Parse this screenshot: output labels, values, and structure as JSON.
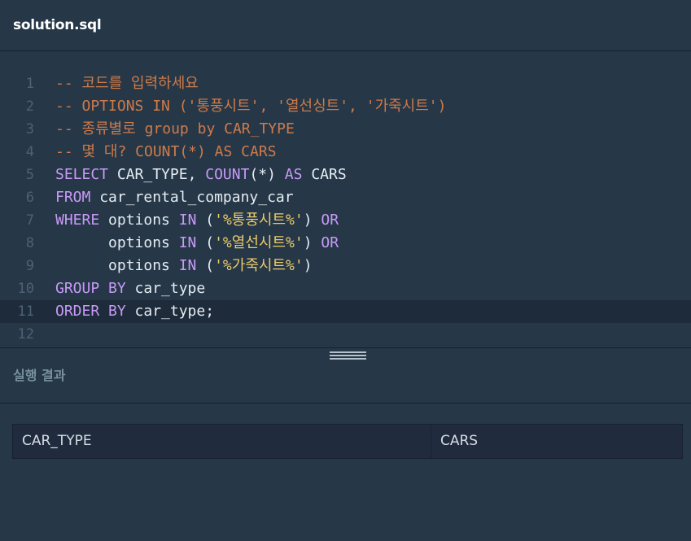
{
  "header": {
    "filename": "solution.sql"
  },
  "editor": {
    "active_line": 11,
    "lines": [
      {
        "n": "1",
        "tokens": [
          [
            "cm",
            "-- 코드를 입력하세요"
          ]
        ]
      },
      {
        "n": "2",
        "tokens": [
          [
            "cm",
            "-- OPTIONS IN ('통풍시트', '열선싱트', '가죽시트')"
          ]
        ]
      },
      {
        "n": "3",
        "tokens": [
          [
            "cm",
            "-- 종류별로 group by CAR_TYPE"
          ]
        ]
      },
      {
        "n": "4",
        "tokens": [
          [
            "cm",
            "-- 몇 대? COUNT(*) AS CARS"
          ]
        ]
      },
      {
        "n": "5",
        "tokens": [
          [
            "kw",
            "SELECT"
          ],
          [
            "id",
            " CAR_TYPE, "
          ],
          [
            "kw",
            "COUNT"
          ],
          [
            "id",
            "(*) "
          ],
          [
            "kw",
            "AS"
          ],
          [
            "id",
            " CARS"
          ]
        ]
      },
      {
        "n": "6",
        "tokens": [
          [
            "kw",
            "FROM"
          ],
          [
            "id",
            " car_rental_company_car"
          ]
        ]
      },
      {
        "n": "7",
        "tokens": [
          [
            "kw",
            "WHERE"
          ],
          [
            "id",
            " options "
          ],
          [
            "kw",
            "IN"
          ],
          [
            "id",
            " ("
          ],
          [
            "str",
            "'%통풍시트%'"
          ],
          [
            "id",
            ") "
          ],
          [
            "kw",
            "OR"
          ]
        ]
      },
      {
        "n": "8",
        "tokens": [
          [
            "id",
            "      options "
          ],
          [
            "kw",
            "IN"
          ],
          [
            "id",
            " ("
          ],
          [
            "str",
            "'%열선시트%'"
          ],
          [
            "id",
            ") "
          ],
          [
            "kw",
            "OR"
          ]
        ]
      },
      {
        "n": "9",
        "tokens": [
          [
            "id",
            "      options "
          ],
          [
            "kw",
            "IN"
          ],
          [
            "id",
            " ("
          ],
          [
            "str",
            "'%가죽시트%'"
          ],
          [
            "id",
            ")"
          ]
        ]
      },
      {
        "n": "10",
        "tokens": [
          [
            "kw",
            "GROUP BY"
          ],
          [
            "id",
            " car_type"
          ]
        ]
      },
      {
        "n": "11",
        "tokens": [
          [
            "kw",
            "ORDER BY"
          ],
          [
            "id",
            " car_type;"
          ]
        ]
      },
      {
        "n": "12",
        "tokens": []
      }
    ]
  },
  "results": {
    "title": "실행 결과",
    "columns": [
      "CAR_TYPE",
      "CARS"
    ]
  }
}
